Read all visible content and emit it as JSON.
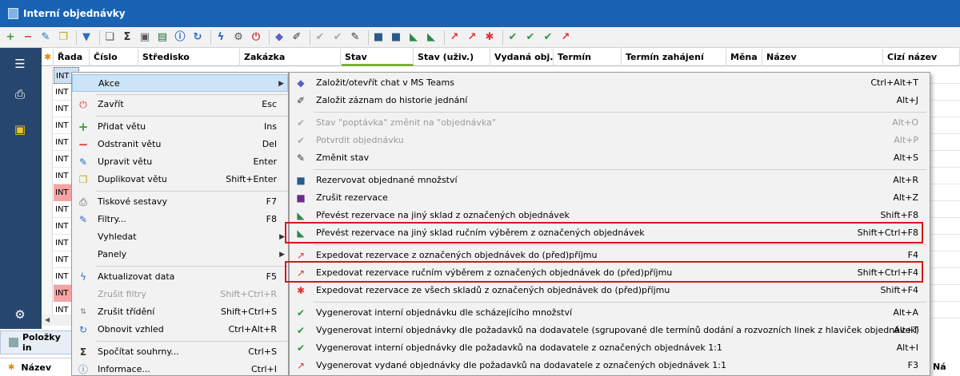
{
  "window": {
    "title": "Interní objednávky"
  },
  "grid": {
    "columns": [
      "Řada",
      "Číslo",
      "Středisko",
      "Zakázka",
      "Stav",
      "Stav (uživ.)",
      "Vydaná obj.",
      "Termín",
      "Termín zahájení",
      "Měna",
      "Název",
      "Cizí název"
    ],
    "row_prefix": "INT"
  },
  "bottom": {
    "panel_label": "Položky in",
    "column_label": "Název",
    "cut_label": "Ná"
  },
  "menu": {
    "items": [
      {
        "label": "Akce",
        "shortcut": ""
      },
      {
        "label": "Zavřít",
        "shortcut": "Esc"
      },
      {
        "label": "Přidat větu",
        "shortcut": "Ins"
      },
      {
        "label": "Odstranit větu",
        "shortcut": "Del"
      },
      {
        "label": "Upravit větu",
        "shortcut": "Enter"
      },
      {
        "label": "Duplikovat větu",
        "shortcut": "Shift+Enter"
      },
      {
        "label": "Tiskové sestavy",
        "shortcut": "F7"
      },
      {
        "label": "Filtry...",
        "shortcut": "F8"
      },
      {
        "label": "Vyhledat",
        "shortcut": ""
      },
      {
        "label": "Panely",
        "shortcut": ""
      },
      {
        "label": "Aktualizovat data",
        "shortcut": "F5"
      },
      {
        "label": "Zrušit filtry",
        "shortcut": "Shift+Ctrl+R"
      },
      {
        "label": "Zrušit třídění",
        "shortcut": "Shift+Ctrl+S"
      },
      {
        "label": "Obnovit vzhled",
        "shortcut": "Ctrl+Alt+R"
      },
      {
        "label": "Spočítat souhrny...",
        "shortcut": "Ctrl+S"
      },
      {
        "label": "Informace...",
        "shortcut": "Ctrl+I"
      }
    ]
  },
  "submenu": {
    "items": [
      {
        "label": "Založit/otevřít chat v MS Teams",
        "shortcut": "Ctrl+Alt+T"
      },
      {
        "label": "Založit záznam do historie jednání",
        "shortcut": "Alt+J"
      },
      {
        "label": "Stav \"poptávka\" změnit na \"objednávka\"",
        "shortcut": "Alt+O"
      },
      {
        "label": "Potvrdit objednávku",
        "shortcut": "Alt+P"
      },
      {
        "label": "Změnit stav",
        "shortcut": "Alt+S"
      },
      {
        "label": "Rezervovat objednané množství",
        "shortcut": "Alt+R"
      },
      {
        "label": "Zrušit rezervace",
        "shortcut": "Alt+Z"
      },
      {
        "label": "Převést rezervace na jiný sklad z označených objednávek",
        "shortcut": "Shift+F8"
      },
      {
        "label": "Převést rezervace na jiný sklad ručním výběrem z označených objednávek",
        "shortcut": "Shift+Ctrl+F8"
      },
      {
        "label": "Expedovat rezervace z označených objednávek do (před)příjmu",
        "shortcut": "F4"
      },
      {
        "label": "Expedovat rezervace ručním výběrem z označených objednávek do (před)příjmu",
        "shortcut": "Shift+Ctrl+F4"
      },
      {
        "label": "Expedovat rezervace ze všech skladů z označených objednávek do (před)příjmu",
        "shortcut": "Shift+F4"
      },
      {
        "label": "Vygenerovat interní objednávku dle scházejícího množství",
        "shortcut": "Alt+A"
      },
      {
        "label": "Vygenerovat interní objednávky dle požadavků na dodavatele (sgrupované dle termínů dodání a rozvozních linek z hlaviček objednávek)",
        "shortcut": "Alt+T"
      },
      {
        "label": "Vygenerovat interní objednávky dle požadavků na dodavatele z označených objednávek 1:1",
        "shortcut": "Alt+I"
      },
      {
        "label": "Vygenerovat vydané objednávky dle požadavků na dodavatele z označených objednávek 1:1",
        "shortcut": "F3"
      }
    ]
  },
  "colors": {
    "titlebar": "#1863b3",
    "sidebar": "#26466d",
    "highlight_box": "#d9161c",
    "row_red": "#f5a3a3",
    "menu_hover": "#cce4f7"
  }
}
